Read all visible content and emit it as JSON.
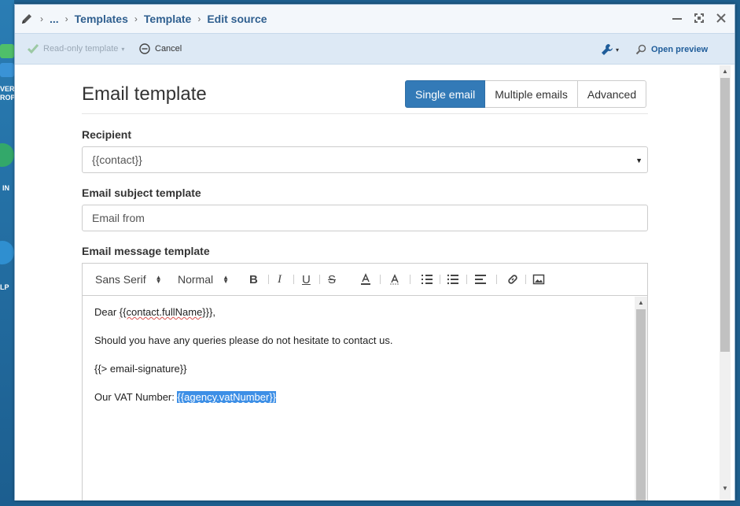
{
  "desktop": {
    "labels": [
      "VER",
      "ROP",
      "IN",
      "LP"
    ]
  },
  "titlebar": {
    "breadcrumbs": [
      "...",
      "Templates",
      "Template",
      "Edit source"
    ]
  },
  "toolbar": {
    "readonly_label": "Read-only template",
    "cancel_label": "Cancel",
    "preview_label": "Open preview"
  },
  "page": {
    "title": "Email template",
    "modes": [
      "Single email",
      "Multiple emails",
      "Advanced"
    ],
    "active_mode": "Single email"
  },
  "form": {
    "recipient_label": "Recipient",
    "recipient_value": "{{contact}}",
    "subject_label": "Email subject template",
    "subject_value": "Email from",
    "message_label": "Email message template"
  },
  "editor": {
    "font": "Sans Serif",
    "size": "Normal",
    "lines": {
      "greeting_prefix": "Dear ",
      "greeting_var": "{{contact.fullName}}",
      "greeting_suffix": "},",
      "queries": "Should you have any queries please do not hesitate to contact us.",
      "signature": "{{> email-signature}}",
      "vat_prefix": "Our VAT Number: ",
      "vat_var_open": "{{",
      "vat_var": "agency.vatNumber",
      "vat_var_close": "}}"
    }
  },
  "colors": {
    "primary": "#337ab7",
    "link": "#1f5d9a",
    "selection": "#3d8fe6"
  }
}
